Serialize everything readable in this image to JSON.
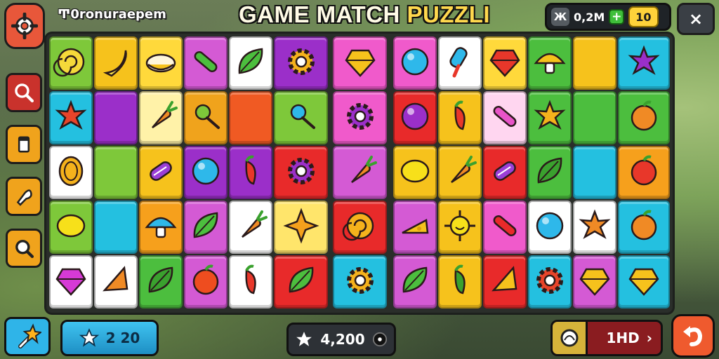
{
  "header": {
    "app_name": "Ͳ0ronuraepem",
    "title_part1": "GAME MATCH ",
    "title_part2": "PUZZLI",
    "currency_icon": "Ж",
    "coins": "0,2M",
    "plus": "+",
    "gems": "10",
    "close": "×"
  },
  "sidebar": {
    "items": [
      {
        "name": "search-icon",
        "color": "#c9322c"
      },
      {
        "name": "pause-icon",
        "color": "#f0a31c"
      },
      {
        "name": "hint-icon",
        "color": "#f0a31c"
      },
      {
        "name": "magnify-icon",
        "color": "#f0a31c"
      }
    ]
  },
  "board": {
    "left": [
      [
        {
          "bg": "#7ec83a",
          "icon": "swirl",
          "c": "#f5d93a"
        },
        {
          "bg": "#f6c21c",
          "icon": "banana",
          "c": "#f7e04a"
        },
        {
          "bg": "#ffd93b",
          "icon": "bowl",
          "c": "#fff6dc"
        },
        {
          "bg": "#d45ad4",
          "icon": "bar",
          "c": "#4cbe3e"
        },
        {
          "bg": "#ffffff",
          "icon": "leaf",
          "c": "#4cbe3e"
        }
      ],
      [
        {
          "bg": "#24c0e0",
          "icon": "star-blob",
          "c": "#e8442a"
        },
        {
          "bg": "#9b2fc9",
          "icon": "none",
          "c": "#000"
        },
        {
          "bg": "#fff2a8",
          "icon": "carrot",
          "c": "#f08a25"
        },
        {
          "bg": "#f0a31c",
          "icon": "pin",
          "c": "#7ec83a"
        },
        {
          "bg": "#f05a23",
          "icon": "none",
          "c": "#000"
        }
      ],
      [
        {
          "bg": "#ffffff",
          "icon": "coin",
          "c": "#f5b21c"
        },
        {
          "bg": "#7ec83a",
          "icon": "none",
          "c": "#000"
        },
        {
          "bg": "#f6c21c",
          "icon": "candy",
          "c": "#9b3fd6"
        },
        {
          "bg": "#9b2fc9",
          "icon": "ball",
          "c": "#2eb8ea"
        },
        {
          "bg": "#9b2fc9",
          "icon": "pepper",
          "c": "#e8372a"
        }
      ],
      [
        {
          "bg": "#7ec83a",
          "icon": "lemon",
          "c": "#f7e01a"
        },
        {
          "bg": "#24c0e0",
          "icon": "none",
          "c": "#000"
        },
        {
          "bg": "#f6a01c",
          "icon": "mushroom",
          "c": "#2eb8ea"
        },
        {
          "bg": "#d45ad4",
          "icon": "leaf",
          "c": "#4cbe3e"
        },
        {
          "bg": "#ffffff",
          "icon": "carrot",
          "c": "#f08a25"
        }
      ],
      [
        {
          "bg": "#ffffff",
          "icon": "gem",
          "c": "#d63ad6"
        },
        {
          "bg": "#ffffff",
          "icon": "wedge",
          "c": "#f08a25"
        },
        {
          "bg": "#4cbe3e",
          "icon": "leaf",
          "c": "#3aa12e"
        },
        {
          "bg": "#d45ad4",
          "icon": "orange",
          "c": "#ee4d1f"
        },
        {
          "bg": "#ffffff",
          "icon": "pepper",
          "c": "#e8372a"
        }
      ]
    ],
    "left_extra_col": [
      {
        "bg": "#9b2fc9",
        "icon": "gear",
        "c": "#f5b21c"
      },
      {
        "bg": "#7ec83a",
        "icon": "pin",
        "c": "#2eb8ea"
      },
      {
        "bg": "#e82a2a",
        "icon": "gear",
        "c": "#9b2fc9"
      },
      {
        "bg": "#ffe56b",
        "icon": "star4",
        "c": "#f5a01c"
      },
      {
        "bg": "#e82a2a",
        "icon": "leaf",
        "c": "#4cbe3e"
      }
    ],
    "mid": [
      {
        "bg": "#f05acb",
        "icon": "gem",
        "c": "#f6c21c"
      },
      {
        "bg": "#f05acb",
        "icon": "gear",
        "c": "#9b2fc9"
      },
      {
        "bg": "#d45ad4",
        "icon": "carrot",
        "c": "#f08a25"
      },
      {
        "bg": "#e82a2a",
        "icon": "swirl",
        "c": "#f5b21c"
      },
      {
        "bg": "#24c0e0",
        "icon": "gear",
        "c": "#f5b21c"
      }
    ],
    "right": [
      [
        {
          "bg": "#f05acb",
          "icon": "ball",
          "c": "#2eb8ea"
        },
        {
          "bg": "#ffffff",
          "icon": "popsicle",
          "c": "#2eb8ea"
        },
        {
          "bg": "#ffd93b",
          "icon": "gem",
          "c": "#e8372a"
        },
        {
          "bg": "#4cbe3e",
          "icon": "mushroom",
          "c": "#f6c21c"
        },
        {
          "bg": "#f6c21c",
          "icon": "none",
          "c": "#000"
        }
      ],
      [
        {
          "bg": "#e82a2a",
          "icon": "ball",
          "c": "#9b2fc9"
        },
        {
          "bg": "#f6c21c",
          "icon": "pepper",
          "c": "#e8372a"
        },
        {
          "bg": "#ffd6f0",
          "icon": "bar",
          "c": "#e854c8"
        },
        {
          "bg": "#4cbe3e",
          "icon": "star-blob",
          "c": "#f5b21c"
        },
        {
          "bg": "#4cbe3e",
          "icon": "none",
          "c": "#000"
        }
      ],
      [
        {
          "bg": "#f6c21c",
          "icon": "lemon",
          "c": "#f7e01a"
        },
        {
          "bg": "#f6c21c",
          "icon": "carrot",
          "c": "#f08a25"
        },
        {
          "bg": "#e82a2a",
          "icon": "candy",
          "c": "#9b3fd6"
        },
        {
          "bg": "#4cbe3e",
          "icon": "leaf",
          "c": "#3aa12e"
        },
        {
          "bg": "#24c0e0",
          "icon": "none",
          "c": "#000"
        }
      ],
      [
        {
          "bg": "#d45ad4",
          "icon": "cheese",
          "c": "#f6c21c"
        },
        {
          "bg": "#f6c21c",
          "icon": "sun",
          "c": "#f7e01a"
        },
        {
          "bg": "#f05acb",
          "icon": "bar",
          "c": "#e82a2a"
        },
        {
          "bg": "#ffffff",
          "icon": "ball",
          "c": "#2eb8ea"
        },
        {
          "bg": "#ffffff",
          "icon": "star-blob",
          "c": "#f08a25"
        }
      ],
      [
        {
          "bg": "#d45ad4",
          "icon": "leaf",
          "c": "#4cbe3e"
        },
        {
          "bg": "#f6c21c",
          "icon": "pepper",
          "c": "#3aa12e"
        },
        {
          "bg": "#e82a2a",
          "icon": "wedge",
          "c": "#f6c21c"
        },
        {
          "bg": "#24c0e0",
          "icon": "gear",
          "c": "#e8442a"
        },
        {
          "bg": "#d45ad4",
          "icon": "gem",
          "c": "#f6c21c"
        }
      ]
    ],
    "right_extra_col": [
      {
        "bg": "#24c0e0",
        "icon": "star-blob",
        "c": "#9b2fc9"
      },
      {
        "bg": "#4cbe3e",
        "icon": "orange",
        "c": "#f08a25"
      },
      {
        "bg": "#f6a01c",
        "icon": "orange",
        "c": "#e8372a"
      },
      {
        "bg": "#24c0e0",
        "icon": "orange",
        "c": "#f08a25"
      },
      {
        "bg": "#24c0e0",
        "icon": "gem",
        "c": "#f6c21c"
      }
    ]
  },
  "footer": {
    "score_left": "2 20",
    "score_mid": "4,200",
    "moves": "1HD",
    "moves_arrow": "›"
  }
}
